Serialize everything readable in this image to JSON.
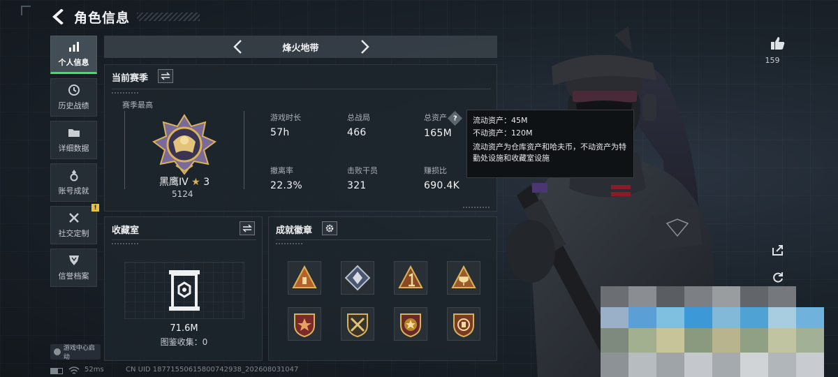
{
  "header": {
    "title": "角色信息"
  },
  "sidebar": {
    "items": [
      {
        "label": "个人信息",
        "icon": "bar-chart-icon",
        "active": true
      },
      {
        "label": "历史战绩",
        "icon": "clock-icon",
        "active": false
      },
      {
        "label": "详细数据",
        "icon": "folder-icon",
        "active": false
      },
      {
        "label": "账号成就",
        "icon": "medal-icon",
        "active": false
      },
      {
        "label": "社交定制",
        "icon": "tools-icon",
        "active": false,
        "badge": "!"
      },
      {
        "label": "信誉档案",
        "icon": "shield-icon",
        "active": false
      }
    ],
    "launcher": "游戏中心启动"
  },
  "mode_selector": {
    "current": "烽火地带"
  },
  "season_panel": {
    "title": "当前赛季",
    "highest_label": "赛季最高",
    "rank_name": "黑鹰IV",
    "rank_stars": "3",
    "rank_score": "5124",
    "stats": [
      {
        "label": "游戏时长",
        "value": "57h"
      },
      {
        "label": "总战局",
        "value": "466"
      },
      {
        "label": "总资产",
        "value": "165M",
        "has_help": true
      },
      {
        "label": "撤离率",
        "value": "22.3%"
      },
      {
        "label": "击败干员",
        "value": "321"
      },
      {
        "label": "赚损比",
        "value": "690.4K"
      }
    ]
  },
  "tooltip": {
    "line1": "流动资产：45M",
    "line2": "不动资产：120M",
    "desc": "流动资产为仓库资产和哈夫币，不动资产为特勤处设施和收藏室设施"
  },
  "collection_panel": {
    "title": "收藏室",
    "value": "71.6M",
    "catalog": "图鉴收集：0"
  },
  "badges_panel": {
    "title": "成就徽章",
    "badges": [
      {
        "icon": "orange-triangle-badge-icon"
      },
      {
        "icon": "crystal-diamond-badge-icon"
      },
      {
        "icon": "number-one-triangle-badge-icon"
      },
      {
        "icon": "trophy-triangle-badge-icon"
      },
      {
        "icon": "red-star-shield-badge-icon"
      },
      {
        "icon": "crossed-guns-shield-badge-icon"
      },
      {
        "icon": "gold-star-shield-badge-icon"
      },
      {
        "icon": "emblem-shield-badge-icon"
      }
    ]
  },
  "likes": {
    "count": "159"
  },
  "status_bar": {
    "ping": "52ms",
    "uid": "CN UID 18771550615800742938_202608031047"
  },
  "colors": {
    "accent": "#3ee06a",
    "gold": "#d9b25a",
    "warning": "#e8c23a"
  }
}
